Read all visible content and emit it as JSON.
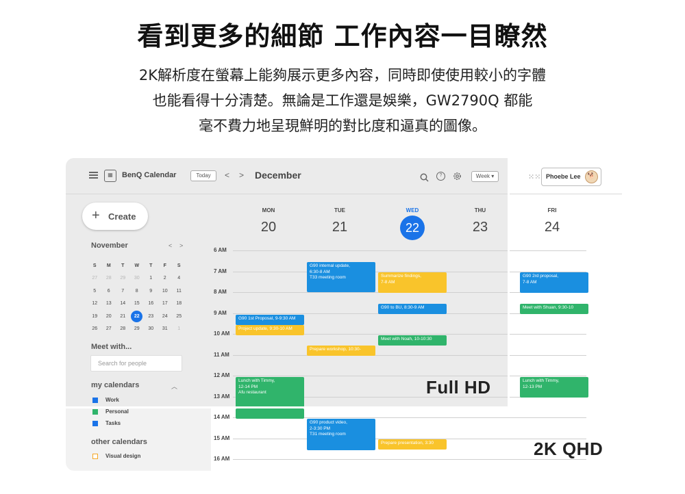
{
  "headline": "看到更多的細節 工作內容一目瞭然",
  "description": [
    "2K解析度在螢幕上能夠展示更多內容，同時即使使用較小的字體",
    "也能看得十分清楚。無論是工作還是娛樂，GW2790Q 都能",
    "毫不費力地呈現鮮明的對比度和逼真的圖像。"
  ],
  "toolbar": {
    "app_name": "BenQ Calendar",
    "today_label": "Today",
    "prev_glyph": "<",
    "next_glyph": ">",
    "month_label": "December",
    "view_label": "Week",
    "user_name": "Phoebe Lee",
    "icons": [
      "menu-icon",
      "calendar-icon",
      "search-icon",
      "help-icon",
      "gear-icon",
      "apps-grid-icon"
    ]
  },
  "sidebar": {
    "create_label": "Create",
    "mini_calendar": {
      "month": "November",
      "weekday_headers": [
        "S",
        "M",
        "T",
        "W",
        "T",
        "F",
        "S"
      ],
      "weeks": [
        [
          "27",
          "28",
          "29",
          "30",
          "1",
          "2",
          "4"
        ],
        [
          "5",
          "6",
          "7",
          "8",
          "9",
          "10",
          "11"
        ],
        [
          "12",
          "13",
          "14",
          "15",
          "16",
          "17",
          "18"
        ],
        [
          "19",
          "20",
          "21",
          "22",
          "23",
          "24",
          "25"
        ],
        [
          "26",
          "27",
          "28",
          "29",
          "30",
          "31",
          "1"
        ]
      ],
      "selected": "22"
    },
    "meet_with_label": "Meet with...",
    "search_placeholder": "Search for people",
    "my_calendars_label": "my calendars",
    "my_calendars": [
      "Work",
      "Personal",
      "Tasks"
    ],
    "other_calendars_label": "other calendars",
    "other_calendars": [
      "Visual design"
    ]
  },
  "days": [
    {
      "name": "MON",
      "num": "20"
    },
    {
      "name": "TUE",
      "num": "21"
    },
    {
      "name": "WED",
      "num": "22"
    },
    {
      "name": "THU",
      "num": "23"
    },
    {
      "name": "FRI",
      "num": "24"
    }
  ],
  "selected_day": "WED",
  "hours": [
    "6 AM",
    "7 AM",
    "8 AM",
    "9 AM",
    "10 AM",
    "11 AM",
    "12 AM",
    "13 AM",
    "14 AM",
    "15 AM",
    "16 AM"
  ],
  "events": [
    {
      "day": "TUE",
      "text": "G90 internal update,\n6:30-8 AM\nT33 meeting room",
      "color": "#1a8fe0"
    },
    {
      "day": "WED",
      "text": "Summarize findings,\n7-8 AM",
      "color": "#f9c42b"
    },
    {
      "day": "FRI",
      "text": "G90 2rd proposal,\n7-8 AM",
      "color": "#1a8fe0"
    },
    {
      "day": "WED",
      "text": "G90 to BU, 8:30-9 AM",
      "color": "#1a8fe0"
    },
    {
      "day": "FRI",
      "text": "Meet with Shuan, 9:30-10",
      "color": "#30b46b"
    },
    {
      "day": "MON",
      "text": "G90 1st Proposal, 9-9:30 AM",
      "color": "#1a8fe0"
    },
    {
      "day": "MON",
      "text": "Project update, 9:30-10 AM",
      "color": "#f9c42b"
    },
    {
      "day": "WED",
      "text": "Meet with Noah, 10-10:30",
      "color": "#30b46b"
    },
    {
      "day": "TUE",
      "text": "Prepare workshop, 10:30-",
      "color": "#f9c42b"
    },
    {
      "day": "MON",
      "text": "Lunch with Timmy,\n12-14 PM\nAfu restaurant",
      "color": "#30b46b"
    },
    {
      "day": "FRI",
      "text": "Lunch with Timmy,\n12-13 PM",
      "color": "#30b46b"
    },
    {
      "day": "TUE",
      "text": "G90 product video,\n2-3:30 PM\nT31 meeting room",
      "color": "#1a8fe0"
    },
    {
      "day": "WED",
      "text": "Prepare presentation, 3:30",
      "color": "#f9c42b"
    }
  ],
  "labels": {
    "full_hd": "Full HD",
    "qhd": "2K QHD"
  }
}
